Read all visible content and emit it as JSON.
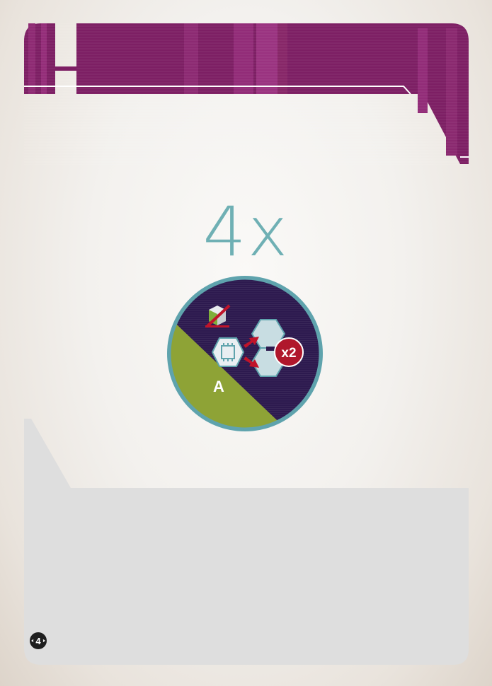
{
  "card": {
    "count_label": "4x",
    "token": {
      "side_label": "A",
      "multiplier_label": "x2"
    },
    "corner_number": "4"
  },
  "colors": {
    "header_purple": "#7d1f64",
    "header_purple_light": "#9a2e7e",
    "count_teal": "#6fb0b4",
    "token_navy": "#2d1a4f",
    "token_green": "#8ea336",
    "token_ring": "#5fa3ad",
    "hex_light": "#c8dde2",
    "badge_red": "#b0172c",
    "arrow_red": "#c0142a",
    "panel_gray": "#dedede"
  },
  "icons": [
    "card-header-banner",
    "cube-crossed-icon",
    "chip-hex-icon",
    "red-arrows-icon",
    "hex-stack-icon",
    "x2-badge-icon",
    "planet-corner-icon"
  ]
}
